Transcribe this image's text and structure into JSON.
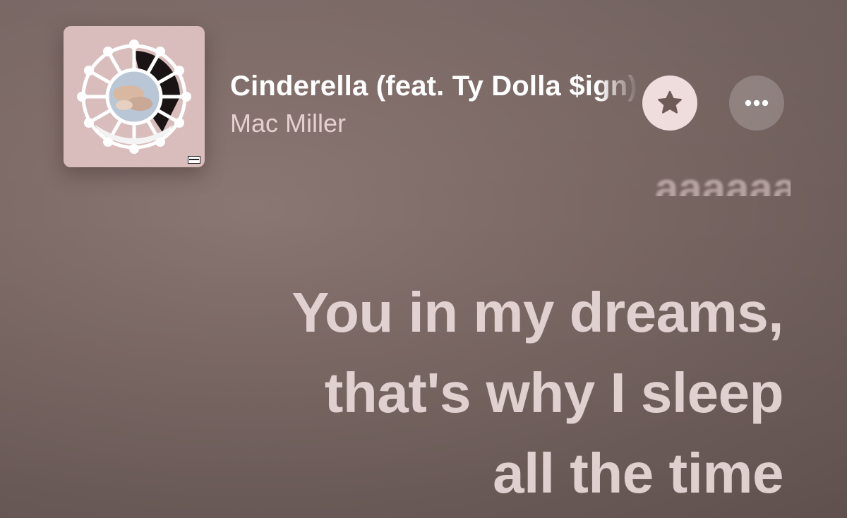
{
  "now_playing": {
    "title": "Cinderella (feat. Ty Dolla $ign)",
    "artist": "Mac Miller",
    "artwork_icon": "album-artwork-icon",
    "favorite_icon": "star-icon",
    "more_icon": "ellipsis-icon"
  },
  "lyrics": {
    "previous_line_partial": "aaaaaa",
    "current_lines": [
      "You in my dreams,",
      "that's why I sleep",
      "all the time"
    ]
  },
  "colors": {
    "background": "#7d6a66",
    "artwork_bg": "#d9bdbd",
    "favorite_bg": "#efdcdc",
    "lyric_text": "#eadada"
  }
}
